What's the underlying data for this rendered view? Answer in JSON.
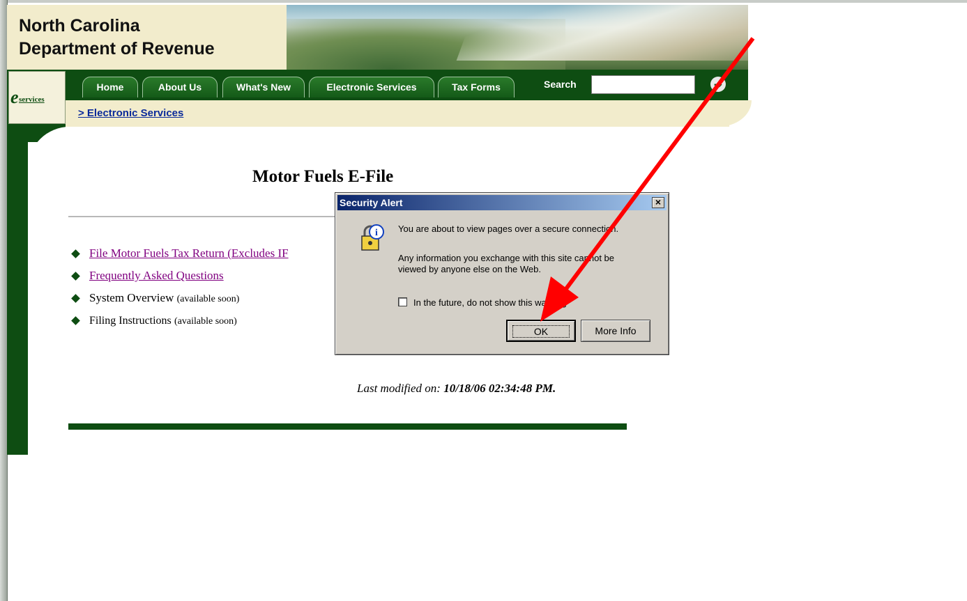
{
  "header": {
    "org_line1": "North Carolina",
    "org_line2": "Department of Revenue",
    "eservices_logo_e": "e",
    "eservices_logo_text": "services"
  },
  "nav": {
    "tabs": [
      "Home",
      "About Us",
      "What's New",
      "Electronic Services",
      "Tax Forms"
    ],
    "search_label": "Search",
    "search_value": ""
  },
  "breadcrumb": "> Electronic Services",
  "main": {
    "title": "Motor Fuels E-File",
    "items": [
      {
        "label": "File Motor Fuels Tax Return (Excludes IF",
        "note": "",
        "is_link": true
      },
      {
        "label": "Frequently Asked Questions",
        "note": "",
        "is_link": true
      },
      {
        "label": "System Overview",
        "note": "(available soon)",
        "is_link": false
      },
      {
        "label": "Filing Instructions",
        "note": "(available soon)",
        "is_link": false
      }
    ],
    "last_modified_label": "Last modified on:",
    "last_modified_value": "10/18/06 02:34:48 PM",
    "last_modified_suffix": "."
  },
  "dialog": {
    "title": "Security Alert",
    "close_glyph": "×",
    "message1": "You are about to view pages over a secure connection.",
    "message2_line1": "Any information you exchange with this site cannot be",
    "message2_line2": "viewed by anyone else on the Web.",
    "checkbox_label": "In the future, do not show this warning",
    "checkbox_checked": false,
    "ok_label": "OK",
    "more_info_label": "More Info"
  },
  "colors": {
    "brand_green": "#0e4d12",
    "cream": "#f2eccc",
    "link_visited": "#800080",
    "arrow_red": "#ff0000"
  }
}
